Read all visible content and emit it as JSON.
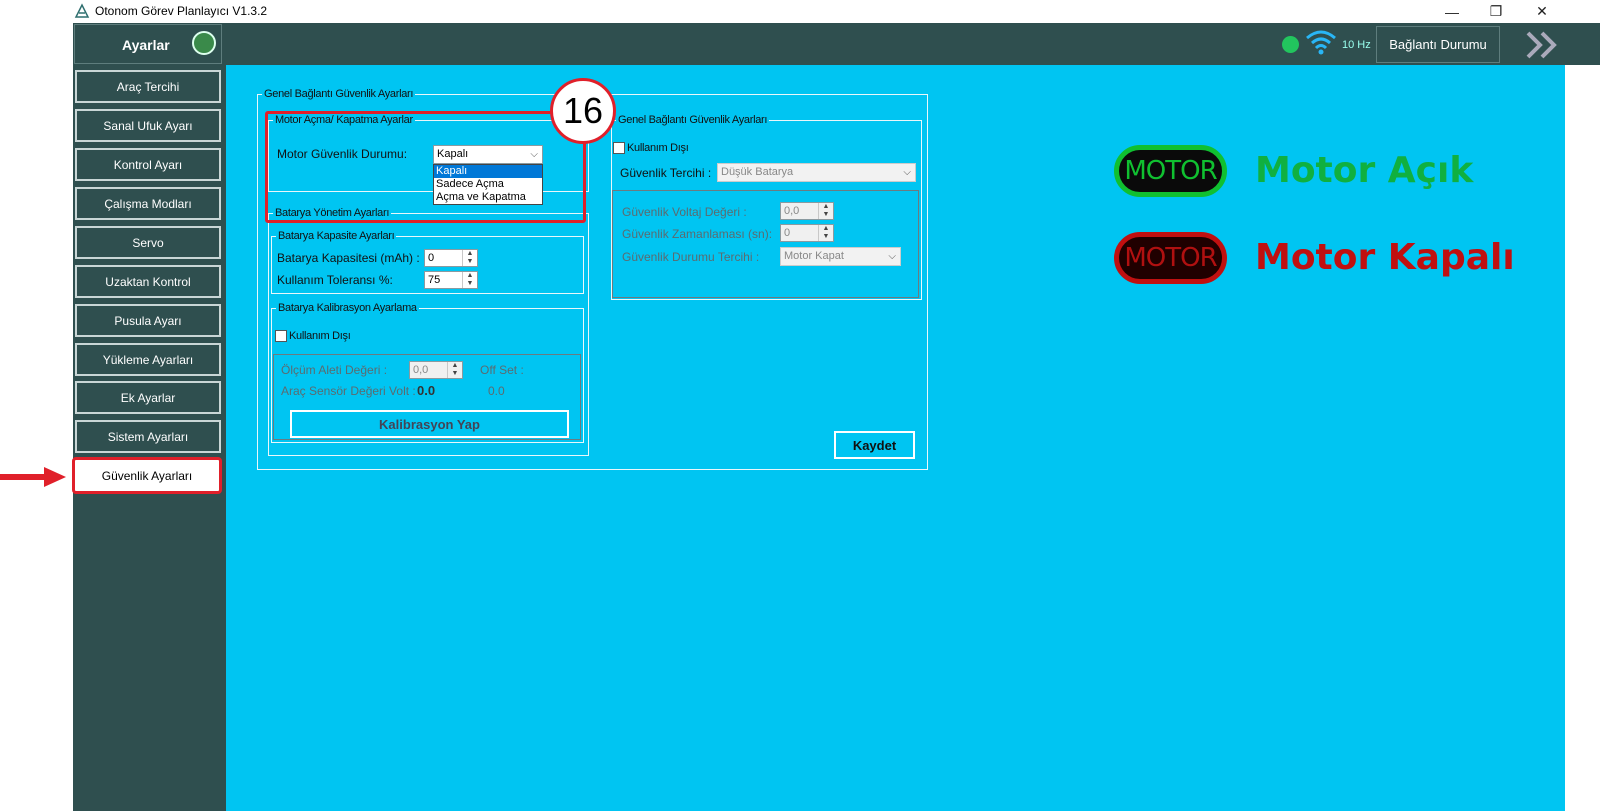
{
  "window": {
    "title": "Otonom Görev Planlayıcı V1.3.2",
    "minimize": "—",
    "restore": "❐",
    "close": "✕"
  },
  "sidebar": {
    "header": "Ayarlar",
    "items": [
      {
        "label": "Araç Tercihi"
      },
      {
        "label": "Sanal Ufuk Ayarı"
      },
      {
        "label": "Kontrol Ayarı"
      },
      {
        "label": "Çalışma Modları"
      },
      {
        "label": "Servo"
      },
      {
        "label": "Uzaktan Kontrol"
      },
      {
        "label": "Pusula Ayarı"
      },
      {
        "label": "Yükleme Ayarları"
      },
      {
        "label": "Ek Ayarlar"
      },
      {
        "label": "Sistem Ayarları"
      },
      {
        "label": "Güvenlik Ayarları",
        "active": true
      }
    ]
  },
  "topbar": {
    "rate": "10 Hz",
    "connection_label": "Bağlantı Durumu",
    "status_color": "#22c55e"
  },
  "callout": "16",
  "outer_group_title": "Genel Bağlantı Güvenlik Ayarları",
  "motor_group": {
    "title": "Motor Açma/ Kapatma Ayarlar",
    "label": "Motor Güvenlik Durumu:",
    "selected": "Kapalı",
    "options": [
      "Kapalı",
      "Sadece Açma",
      "Açma ve Kapatma"
    ]
  },
  "battery_group": {
    "title": "Batarya Yönetim Ayarları",
    "capacity_group": {
      "title": "Batarya Kapasite Ayarları",
      "capacity_label": "Batarya Kapasitesi (mAh) :",
      "capacity_value": "0",
      "tolerance_label": "Kullanım Toleransı %:",
      "tolerance_value": "75"
    },
    "calibration_group": {
      "title": "Batarya Kalibrasyon Ayarlama",
      "disabled_label": "Kullanım Dışı",
      "meter_label": "Ölçüm Aleti Değeri :",
      "meter_value": "0,0",
      "offset_label": "Off Set :",
      "sensor_label": "Araç Sensör Değeri Volt :",
      "sensor_value": "0.0",
      "offset_value": "0.0",
      "calibrate_button": "Kalibrasyon Yap"
    }
  },
  "link_group": {
    "title": "Genel Bağlantı Güvenlik Ayarları",
    "disabled_label": "Kullanım Dışı",
    "pref_label": "Güvenlik Tercihi :",
    "pref_value": "Düşük Batarya",
    "voltage_label": "Güvenlik Voltaj Değeri :",
    "voltage_value": "0,0",
    "timing_label": "Güvenlik Zamanlaması (sn):",
    "timing_value": "0",
    "state_label": "Güvenlik Durumu Tercihi :",
    "state_value": "Motor Kapat"
  },
  "save_button": "Kaydet",
  "legend": {
    "on_badge": "MOTOR",
    "on_text": "Motor Açık",
    "on_color": "#10b040",
    "off_badge": "MOTOR",
    "off_text": "Motor Kapalı",
    "off_color": "#c01010"
  }
}
